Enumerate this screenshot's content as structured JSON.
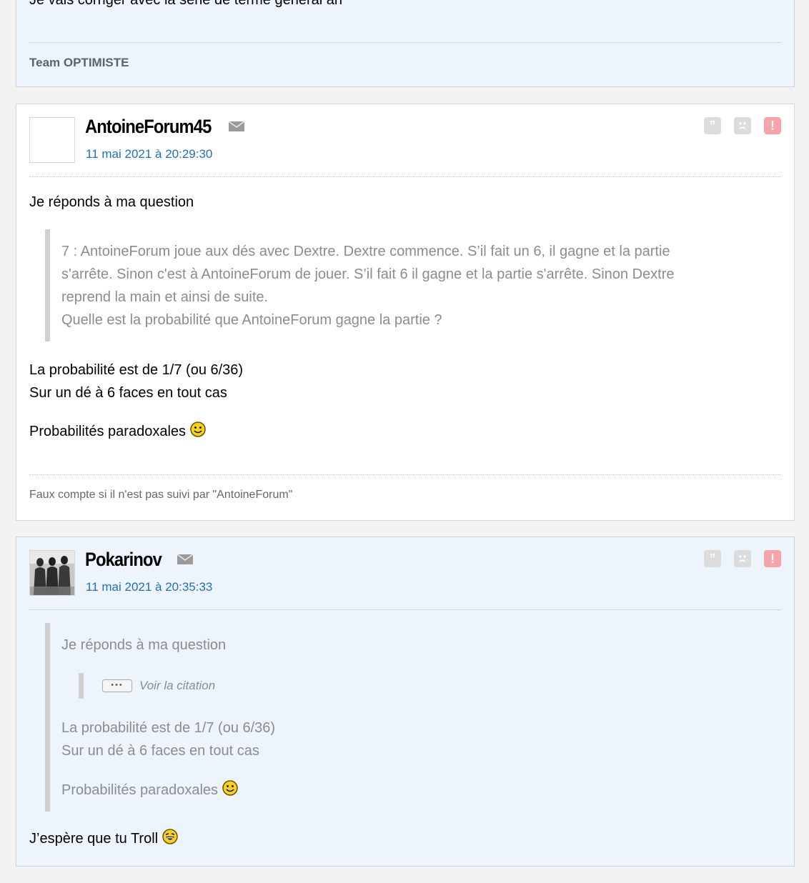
{
  "previous_post": {
    "cut_text": "Je vais corriger avec  la série de terme général an",
    "signature": "Team OPTIMISTE"
  },
  "posts": [
    {
      "username": "AntoineForum45",
      "date": "11 mai 2021 à 20:29:30",
      "intro": "Je réponds à ma question",
      "quote_lines": [
        "7 : AntoineForum joue aux dés avec Dextre. Dextre commence. S’il fait un 6, il gagne et la partie",
        "s'arrête. Sinon c'est à AntoineForum de jouer. S’il fait 6 il gagne et la partie s'arrête. Sinon Dextre",
        "reprend la main et ainsi de suite.",
        "Quelle est la probabilité que AntoineForum gagne la partie ?"
      ],
      "answer_lines": [
        "La probabilité est de 1/7 (ou 6/36)",
        "Sur un dé à 6 faces en tout cas"
      ],
      "closing": "Probabilités paradoxales",
      "signature": "Faux compte si il n'est pas suivi par \"AntoineForum\""
    },
    {
      "username": "Pokarinov",
      "date": "11 mai 2021 à 20:35:33",
      "quote_intro": "Je réponds à ma question",
      "see_citation": "Voir la citation",
      "quote_lines": [
        "La probabilité est de 1/7 (ou 6/36)",
        "Sur un dé à 6 faces en tout cas"
      ],
      "quote_closing": "Probabilités paradoxales",
      "body": "J’espère que tu Troll"
    }
  ],
  "icons": {
    "mail": "envelope-icon",
    "quote": "quote-icon",
    "sad": "sad-face-icon",
    "report": "exclamation-icon",
    "smiley": "smiley-icon",
    "laugh": "laughing-face-icon"
  },
  "colors": {
    "link": "#1f6fbf",
    "report": "#f5a5aa",
    "post_blue_bg": "#eef4fc"
  }
}
